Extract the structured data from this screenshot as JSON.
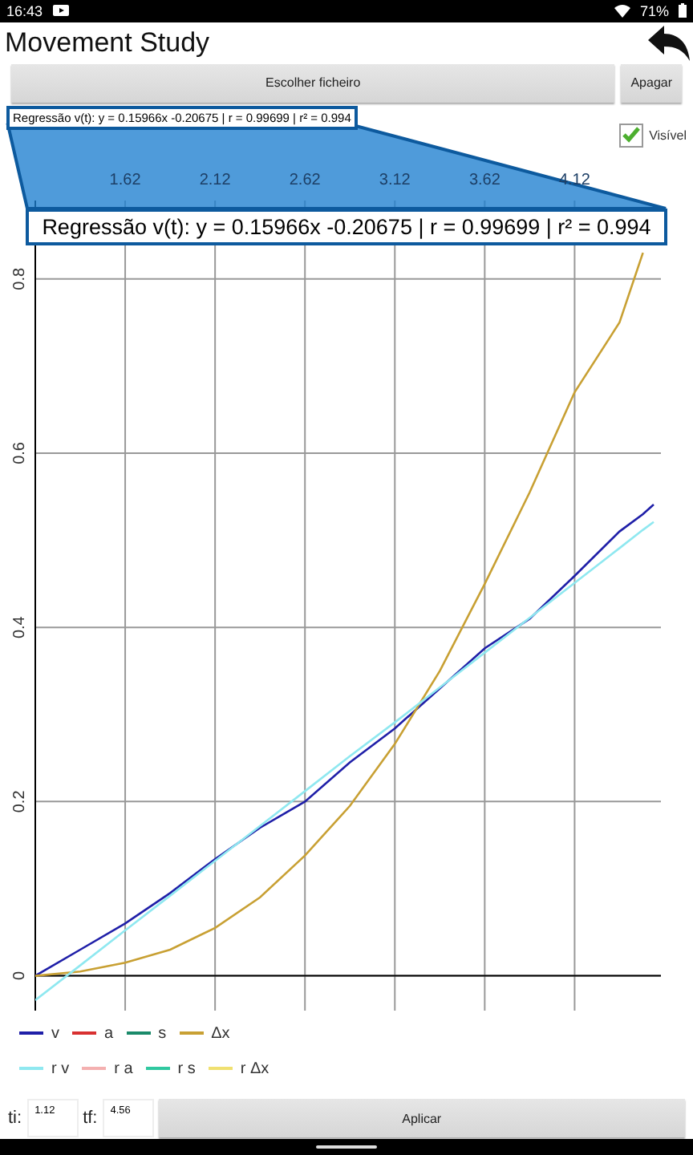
{
  "status_bar": {
    "time": "16:43",
    "battery": "71%"
  },
  "app_bar": {
    "title": "Movement Study"
  },
  "toolbar": {
    "buttons": [
      {
        "label": "Escolher ficheiro"
      },
      {
        "label": "Apagar"
      }
    ]
  },
  "regression": {
    "summary": "Regressão v(t): y = 0.15966x -0.20675 | r = 0.99699 | r² = 0.994",
    "callout": "Regressão v(t): y = 0.15966x -0.20675 | r = 0.99699 | r² = 0.994"
  },
  "visible_checkbox": {
    "label": "Visível",
    "checked": true
  },
  "chart": {
    "chart_data": {
      "type": "line",
      "grid": true,
      "x": [
        1.12,
        1.37,
        1.62,
        1.87,
        2.12,
        2.37,
        2.62,
        2.87,
        3.12,
        3.37,
        3.62,
        3.87,
        4.12,
        4.37,
        4.5,
        4.56
      ],
      "xlim": [
        1.12,
        4.6
      ],
      "ylim": [
        -0.04,
        0.89
      ],
      "xticks": [
        1.62,
        2.12,
        2.62,
        3.12,
        3.62,
        4.12
      ],
      "yticks": [
        0,
        0.2,
        0.4,
        0.6,
        0.8
      ],
      "series": [
        {
          "name": "v",
          "color": "#1f1fa8",
          "values": [
            0,
            0.03,
            0.06,
            0.095,
            0.134,
            0.17,
            0.2,
            0.245,
            0.284,
            0.33,
            0.376,
            0.41,
            0.459,
            0.51,
            0.53,
            0.541
          ]
        },
        {
          "name": "a",
          "color": "#d83030",
          "values": [
            null,
            null,
            null,
            null,
            null,
            null,
            null,
            null,
            null,
            null,
            null,
            null,
            null,
            null,
            null,
            null
          ]
        },
        {
          "name": "s",
          "color": "#1a8a6a",
          "values": [
            null,
            null,
            null,
            null,
            null,
            null,
            null,
            null,
            null,
            null,
            null,
            null,
            null,
            null,
            null,
            null
          ]
        },
        {
          "name": "Δx",
          "color": "#c8a033",
          "values": [
            0,
            0.005,
            0.015,
            0.03,
            0.055,
            0.09,
            0.138,
            0.195,
            0.266,
            0.35,
            0.45,
            0.555,
            0.67,
            0.75,
            0.83,
            null
          ]
        },
        {
          "name": "r v",
          "color": "#8fe8f0",
          "values": [
            -0.028,
            0.012,
            0.052,
            0.092,
            0.132,
            0.172,
            0.212,
            0.252,
            0.291,
            0.331,
            0.371,
            0.411,
            0.451,
            0.491,
            0.512,
            0.521
          ]
        },
        {
          "name": "r a",
          "color": "#f4b0b0",
          "values": [
            null,
            null,
            null,
            null,
            null,
            null,
            null,
            null,
            null,
            null,
            null,
            null,
            null,
            null,
            null,
            null
          ]
        },
        {
          "name": "r s",
          "color": "#30c8a0",
          "values": [
            null,
            null,
            null,
            null,
            null,
            null,
            null,
            null,
            null,
            null,
            null,
            null,
            null,
            null,
            null,
            null
          ]
        },
        {
          "name": "r Δx",
          "color": "#f0e070",
          "values": [
            null,
            null,
            null,
            null,
            null,
            null,
            null,
            null,
            null,
            null,
            null,
            null,
            null,
            null,
            null,
            null
          ]
        }
      ]
    }
  },
  "range": {
    "ti_label": "ti:",
    "ti_value": "1.12",
    "tf_label": "tf:",
    "tf_value": "4.56",
    "apply_button": "Aplicar"
  }
}
